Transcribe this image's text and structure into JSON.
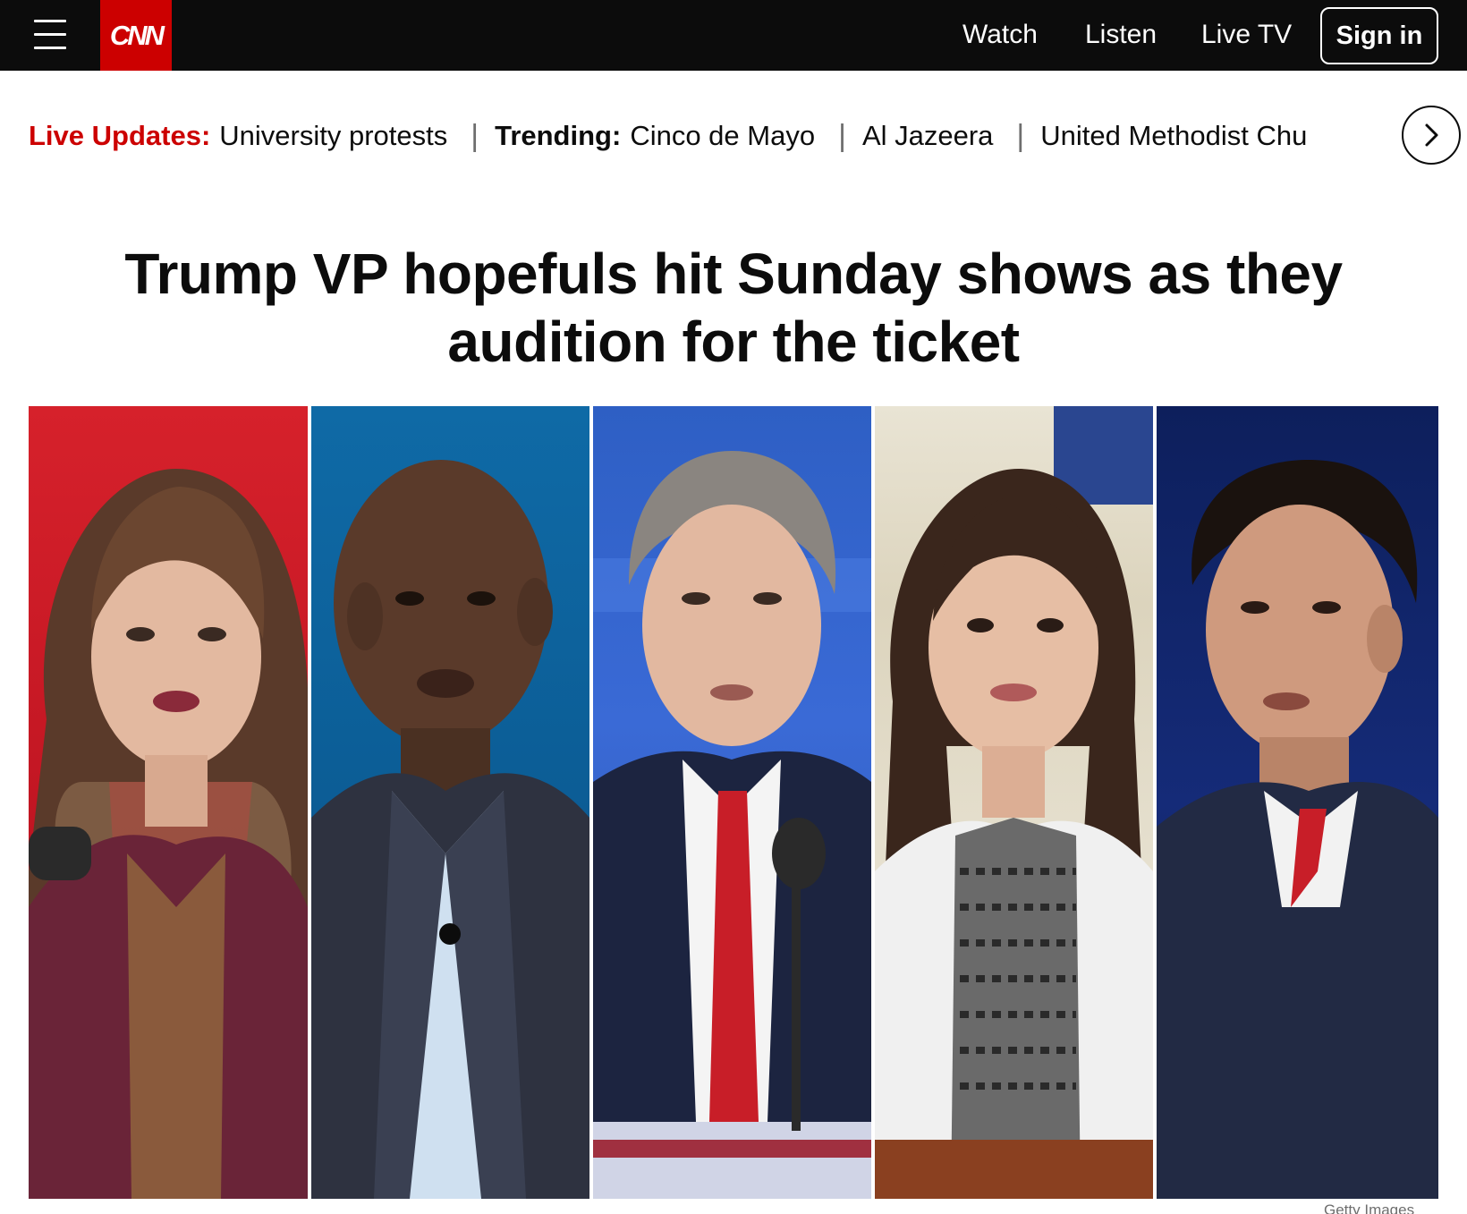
{
  "nav": {
    "logo": "CNN",
    "watch": "Watch",
    "listen": "Listen",
    "live_tv": "Live TV",
    "sign_in": "Sign in"
  },
  "trending": {
    "live_updates_label": "Live Updates:",
    "live_updates_link": "University protests",
    "trending_label": "Trending:",
    "links": [
      "Cinco de Mayo",
      "Al Jazeera",
      "United Methodist Chu"
    ]
  },
  "article": {
    "headline": "Trump VP hopefuls hit Sunday shows as they audition for the ticket",
    "image_credit": "Getty Images"
  },
  "colors": {
    "brand_red": "#cc0000",
    "nav_bg": "#0c0c0c"
  },
  "icons": [
    "hamburger-menu-icon",
    "chevron-right-icon"
  ]
}
